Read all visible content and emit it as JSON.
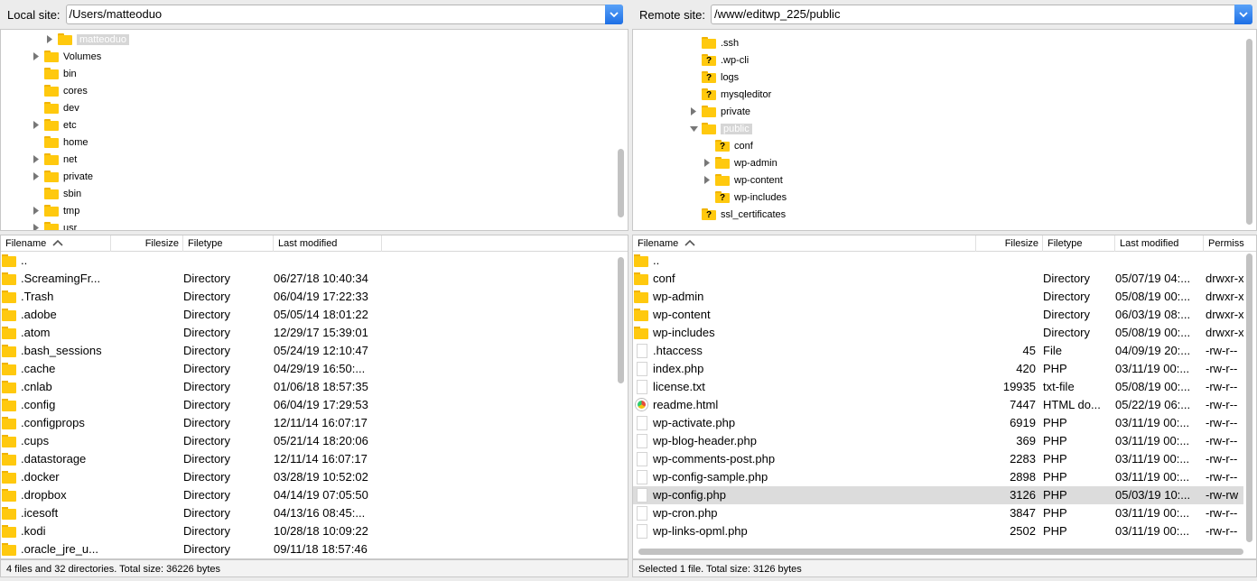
{
  "local": {
    "label": "Local site:",
    "path": "/Users/matteoduo",
    "tree": [
      {
        "name": "matteoduo",
        "depth": 1,
        "expand": "closed",
        "selected": true
      },
      {
        "name": "Volumes",
        "depth": 0,
        "expand": "closed"
      },
      {
        "name": "bin",
        "depth": 0,
        "expand": "none"
      },
      {
        "name": "cores",
        "depth": 0,
        "expand": "none"
      },
      {
        "name": "dev",
        "depth": 0,
        "expand": "none"
      },
      {
        "name": "etc",
        "depth": 0,
        "expand": "closed"
      },
      {
        "name": "home",
        "depth": 0,
        "expand": "none"
      },
      {
        "name": "net",
        "depth": 0,
        "expand": "closed"
      },
      {
        "name": "private",
        "depth": 0,
        "expand": "closed"
      },
      {
        "name": "sbin",
        "depth": 0,
        "expand": "none"
      },
      {
        "name": "tmp",
        "depth": 0,
        "expand": "closed"
      },
      {
        "name": "usr",
        "depth": 0,
        "expand": "closed"
      }
    ],
    "columns": {
      "filename": "Filename",
      "filesize": "Filesize",
      "filetype": "Filetype",
      "modified": "Last modified"
    },
    "files": [
      {
        "name": "..",
        "size": "",
        "type": "",
        "modified": "",
        "icon": "folder"
      },
      {
        "name": ".ScreamingFr...",
        "size": "",
        "type": "Directory",
        "modified": "06/27/18 10:40:34",
        "icon": "folder"
      },
      {
        "name": ".Trash",
        "size": "",
        "type": "Directory",
        "modified": "06/04/19 17:22:33",
        "icon": "folder"
      },
      {
        "name": ".adobe",
        "size": "",
        "type": "Directory",
        "modified": "05/05/14 18:01:22",
        "icon": "folder"
      },
      {
        "name": ".atom",
        "size": "",
        "type": "Directory",
        "modified": "12/29/17 15:39:01",
        "icon": "folder"
      },
      {
        "name": ".bash_sessions",
        "size": "",
        "type": "Directory",
        "modified": "05/24/19 12:10:47",
        "icon": "folder"
      },
      {
        "name": ".cache",
        "size": "",
        "type": "Directory",
        "modified": "04/29/19 16:50:...",
        "icon": "folder"
      },
      {
        "name": ".cnlab",
        "size": "",
        "type": "Directory",
        "modified": "01/06/18 18:57:35",
        "icon": "folder"
      },
      {
        "name": ".config",
        "size": "",
        "type": "Directory",
        "modified": "06/04/19 17:29:53",
        "icon": "folder"
      },
      {
        "name": ".configprops",
        "size": "",
        "type": "Directory",
        "modified": "12/11/14 16:07:17",
        "icon": "folder"
      },
      {
        "name": ".cups",
        "size": "",
        "type": "Directory",
        "modified": "05/21/14 18:20:06",
        "icon": "folder"
      },
      {
        "name": ".datastorage",
        "size": "",
        "type": "Directory",
        "modified": "12/11/14 16:07:17",
        "icon": "folder"
      },
      {
        "name": ".docker",
        "size": "",
        "type": "Directory",
        "modified": "03/28/19 10:52:02",
        "icon": "folder"
      },
      {
        "name": ".dropbox",
        "size": "",
        "type": "Directory",
        "modified": "04/14/19 07:05:50",
        "icon": "folder"
      },
      {
        "name": ".icesoft",
        "size": "",
        "type": "Directory",
        "modified": "04/13/16 08:45:...",
        "icon": "folder"
      },
      {
        "name": ".kodi",
        "size": "",
        "type": "Directory",
        "modified": "10/28/18 10:09:22",
        "icon": "folder"
      },
      {
        "name": ".oracle_jre_u...",
        "size": "",
        "type": "Directory",
        "modified": "09/11/18 18:57:46",
        "icon": "folder"
      }
    ],
    "status": "4 files and 32 directories. Total size: 36226 bytes"
  },
  "remote": {
    "label": "Remote site:",
    "path": "/www/editwp_225/public",
    "tree": [
      {
        "name": ".ssh",
        "depth": 0,
        "expand": "none",
        "q": false
      },
      {
        "name": ".wp-cli",
        "depth": 0,
        "expand": "none",
        "q": true
      },
      {
        "name": "logs",
        "depth": 0,
        "expand": "none",
        "q": true
      },
      {
        "name": "mysqleditor",
        "depth": 0,
        "expand": "none",
        "q": true
      },
      {
        "name": "private",
        "depth": 0,
        "expand": "closed",
        "q": false
      },
      {
        "name": "public",
        "depth": 0,
        "expand": "open",
        "q": false,
        "selected": true
      },
      {
        "name": "conf",
        "depth": 1,
        "expand": "none",
        "q": true
      },
      {
        "name": "wp-admin",
        "depth": 1,
        "expand": "closed",
        "q": false
      },
      {
        "name": "wp-content",
        "depth": 1,
        "expand": "closed",
        "q": false
      },
      {
        "name": "wp-includes",
        "depth": 1,
        "expand": "none",
        "q": true
      },
      {
        "name": "ssl_certificates",
        "depth": 0,
        "expand": "none",
        "q": true
      }
    ],
    "columns": {
      "filename": "Filename",
      "filesize": "Filesize",
      "filetype": "Filetype",
      "modified": "Last modified",
      "perms": "Permiss"
    },
    "files": [
      {
        "name": "..",
        "size": "",
        "type": "",
        "modified": "",
        "perms": "",
        "icon": "folder"
      },
      {
        "name": "conf",
        "size": "",
        "type": "Directory",
        "modified": "05/07/19 04:...",
        "perms": "drwxr-x",
        "icon": "folder"
      },
      {
        "name": "wp-admin",
        "size": "",
        "type": "Directory",
        "modified": "05/08/19 00:...",
        "perms": "drwxr-x",
        "icon": "folder"
      },
      {
        "name": "wp-content",
        "size": "",
        "type": "Directory",
        "modified": "06/03/19 08:...",
        "perms": "drwxr-x",
        "icon": "folder"
      },
      {
        "name": "wp-includes",
        "size": "",
        "type": "Directory",
        "modified": "05/08/19 00:...",
        "perms": "drwxr-x",
        "icon": "folder"
      },
      {
        "name": ".htaccess",
        "size": "45",
        "type": "File",
        "modified": "04/09/19 20:...",
        "perms": "-rw-r--",
        "icon": "file"
      },
      {
        "name": "index.php",
        "size": "420",
        "type": "PHP",
        "modified": "03/11/19 00:...",
        "perms": "-rw-r--",
        "icon": "file"
      },
      {
        "name": "license.txt",
        "size": "19935",
        "type": "txt-file",
        "modified": "05/08/19 00:...",
        "perms": "-rw-r--",
        "icon": "file"
      },
      {
        "name": "readme.html",
        "size": "7447",
        "type": "HTML do...",
        "modified": "05/22/19 06:...",
        "perms": "-rw-r--",
        "icon": "html"
      },
      {
        "name": "wp-activate.php",
        "size": "6919",
        "type": "PHP",
        "modified": "03/11/19 00:...",
        "perms": "-rw-r--",
        "icon": "file"
      },
      {
        "name": "wp-blog-header.php",
        "size": "369",
        "type": "PHP",
        "modified": "03/11/19 00:...",
        "perms": "-rw-r--",
        "icon": "file"
      },
      {
        "name": "wp-comments-post.php",
        "size": "2283",
        "type": "PHP",
        "modified": "03/11/19 00:...",
        "perms": "-rw-r--",
        "icon": "file"
      },
      {
        "name": "wp-config-sample.php",
        "size": "2898",
        "type": "PHP",
        "modified": "03/11/19 00:...",
        "perms": "-rw-r--",
        "icon": "file"
      },
      {
        "name": "wp-config.php",
        "size": "3126",
        "type": "PHP",
        "modified": "05/03/19 10:...",
        "perms": "-rw-rw",
        "icon": "file",
        "selected": true
      },
      {
        "name": "wp-cron.php",
        "size": "3847",
        "type": "PHP",
        "modified": "03/11/19 00:...",
        "perms": "-rw-r--",
        "icon": "file"
      },
      {
        "name": "wp-links-opml.php",
        "size": "2502",
        "type": "PHP",
        "modified": "03/11/19 00:...",
        "perms": "-rw-r--",
        "icon": "file"
      }
    ],
    "status": "Selected 1 file. Total size: 3126 bytes"
  }
}
